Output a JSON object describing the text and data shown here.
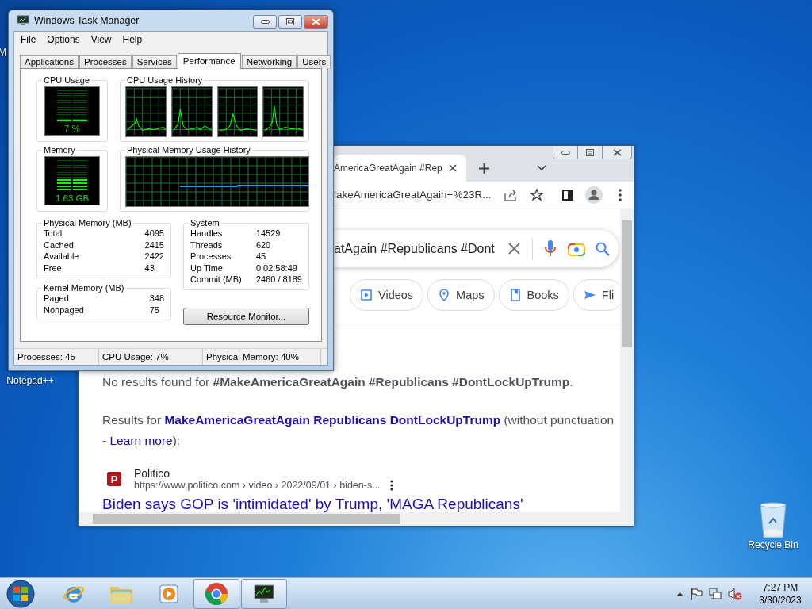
{
  "desktop_icons": [
    {
      "kind": "hidden",
      "label": "M"
    },
    {
      "kind": "hidden",
      "label": "Notepad++"
    },
    {
      "kind": "recycle_bin",
      "label": "Recycle Bin"
    }
  ],
  "browser": {
    "tab": {
      "title": "AmericaGreatAgain #Rep"
    },
    "address": "lakeAmericaGreatAgain+%23R...",
    "search": {
      "value": "atAgain #Republicans #Dont"
    },
    "chips": [
      {
        "kind": "videos",
        "label": "Videos"
      },
      {
        "kind": "maps",
        "label": "Maps"
      },
      {
        "kind": "books",
        "label": "Books"
      },
      {
        "kind": "flights",
        "label": "Fli"
      }
    ],
    "no_results": "No results found for **#MakeAmericaGreatAgain #Republicans #DontLockUpTrump**.",
    "results_for": {
      "prefix": "Results for ",
      "query_link": "MakeAmericaGreatAgain Republicans DontLockUpTrump",
      "middle": " (without punctuation - ",
      "learn_more": "Learn more",
      "suffix": "):"
    },
    "result": {
      "favicon": "P",
      "site": "Politico",
      "url": "https://www.politico.com › video › 2022/09/01 › biden-s...",
      "title": "Biden says GOP is 'intimidated' by Trump, 'MAGA Republicans'"
    }
  },
  "task_manager": {
    "title": "Windows Task Manager",
    "menu": [
      "File",
      "Options",
      "View",
      "Help"
    ],
    "tabs": [
      {
        "label": "Applications",
        "selected": false
      },
      {
        "label": "Processes",
        "selected": false
      },
      {
        "label": "Services",
        "selected": false
      },
      {
        "label": "Performance",
        "selected": true
      },
      {
        "label": "Networking",
        "selected": false
      },
      {
        "label": "Users",
        "selected": false
      }
    ],
    "cpu_usage": {
      "title": "CPU Usage",
      "reading": "7 %",
      "level": 0.07
    },
    "cpu_history": {
      "title": "CPU Usage History"
    },
    "memory": {
      "title": "Memory",
      "reading": "1.63 GB",
      "level": 0.4
    },
    "memory_history": {
      "title": "Physical Memory Usage History"
    },
    "physical_memory": {
      "title": "Physical Memory (MB)",
      "rows": [
        {
          "label": "Total",
          "value": "4095"
        },
        {
          "label": "Cached",
          "value": "2415"
        },
        {
          "label": "Available",
          "value": "2422"
        },
        {
          "label": "Free",
          "value": "43"
        }
      ]
    },
    "kernel_memory": {
      "title": "Kernel Memory (MB)",
      "rows": [
        {
          "label": "Paged",
          "value": "348"
        },
        {
          "label": "Nonpaged",
          "value": "75"
        }
      ]
    },
    "system": {
      "title": "System",
      "rows": [
        {
          "label": "Handles",
          "value": "14529"
        },
        {
          "label": "Threads",
          "value": "620"
        },
        {
          "label": "Processes",
          "value": "45"
        },
        {
          "label": "Up Time",
          "value": "0:02:58:49"
        },
        {
          "label": "Commit (MB)",
          "value": "2460 / 8189"
        }
      ]
    },
    "resource_monitor_button": "Resource Monitor...",
    "status_bar": [
      "Processes: 45",
      "CPU Usage: 7%",
      "Physical Memory: 40%"
    ]
  },
  "taskbar": {
    "items": [
      {
        "kind": "browser",
        "open": false
      },
      {
        "kind": "folder",
        "open": false
      },
      {
        "kind": "media",
        "open": false
      },
      {
        "kind": "chrome",
        "open": true
      },
      {
        "kind": "monitor",
        "open": true
      }
    ],
    "time": "7:27 PM",
    "date": "3/30/2023"
  }
}
